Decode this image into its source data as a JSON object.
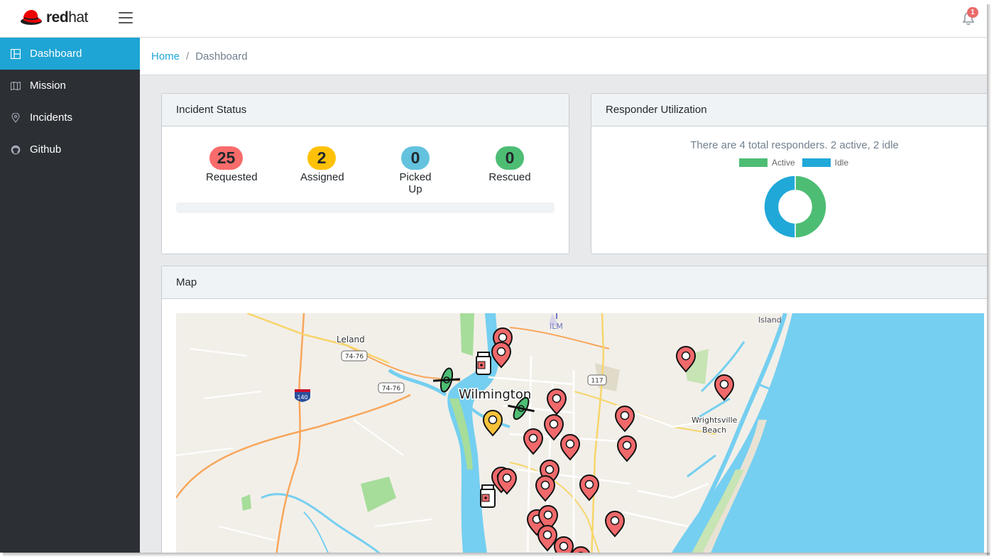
{
  "header": {
    "brand_bold": "red",
    "brand_light": "hat",
    "notification_count": "1"
  },
  "sidebar": {
    "items": [
      {
        "label": "Dashboard",
        "icon": "layout-icon",
        "active": true
      },
      {
        "label": "Mission",
        "icon": "map-icon",
        "active": false
      },
      {
        "label": "Incidents",
        "icon": "location-pin-icon",
        "active": false
      },
      {
        "label": "Github",
        "icon": "github-icon",
        "active": false
      }
    ]
  },
  "breadcrumb": {
    "home": "Home",
    "separator": "/",
    "current": "Dashboard"
  },
  "incident_status": {
    "title": "Incident Status",
    "stats": [
      {
        "value": "25",
        "label": "Requested",
        "color": "#f86c6b"
      },
      {
        "value": "2",
        "label": "Assigned",
        "color": "#ffc107"
      },
      {
        "value": "0",
        "label": "Picked Up",
        "color": "#63c2de"
      },
      {
        "value": "0",
        "label": "Rescued",
        "color": "#4dbd74"
      }
    ],
    "progress_fraction": 0
  },
  "responder_utilization": {
    "title": "Responder Utilization",
    "summary": "There are 4 total responders. 2 active, 2 idle",
    "legend": [
      {
        "label": "Active",
        "color": "#4dbd74"
      },
      {
        "label": "Idle",
        "color": "#20a8d8"
      }
    ]
  },
  "chart_data": {
    "type": "pie",
    "categories": [
      "Active",
      "Idle"
    ],
    "values": [
      2,
      2
    ],
    "title": "",
    "colors": [
      "#4dbd74",
      "#20a8d8"
    ]
  },
  "map": {
    "title": "Map",
    "labels": {
      "city": "Wilmington",
      "leland": "Leland",
      "airport": "ILM",
      "island": "Island",
      "wrightsville_1": "Wrightsville",
      "wrightsville_2": "Beach",
      "shield_7476a": "74-76",
      "shield_7476b": "74-76",
      "shield_117": "117",
      "shield_140": "140"
    },
    "marker_colors": {
      "requested": "#f0696b",
      "assigned": "#f7c23a",
      "responder_boat": "#4dbd74"
    }
  }
}
